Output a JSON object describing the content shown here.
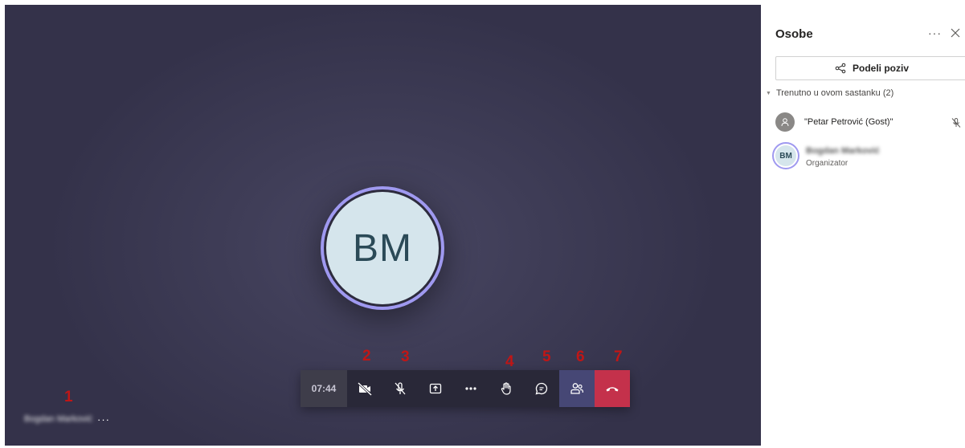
{
  "stage": {
    "participant_initials": "BM",
    "self_name": "Bogdan Marković",
    "self_more": "···"
  },
  "annotations": [
    "1",
    "2",
    "3",
    "4",
    "5",
    "6",
    "7"
  ],
  "toolbar": {
    "call_duration": "07:44",
    "buttons": [
      {
        "icon": "camera-off-icon"
      },
      {
        "icon": "mic-off-icon"
      },
      {
        "icon": "share-screen-icon"
      },
      {
        "icon": "more-options-icon"
      },
      {
        "icon": "raise-hand-icon"
      },
      {
        "icon": "chat-icon"
      },
      {
        "icon": "people-icon"
      },
      {
        "icon": "hang-up-icon"
      }
    ],
    "colors": {
      "bar": "#292838",
      "people_active": "#464775",
      "hangup": "#c4314b"
    }
  },
  "panel": {
    "title": "Osobe",
    "more": "···",
    "share_label": "Podeli poziv",
    "section_label": "Trenutno u ovom sastanku (2)",
    "participants": [
      {
        "name": "\"Petar Petrović (Gost)\"",
        "role": "",
        "muted": true
      },
      {
        "name": "Bogdan Marković",
        "initials": "BM",
        "role": "Organizator"
      }
    ]
  },
  "accent_color": "#9f99f0"
}
